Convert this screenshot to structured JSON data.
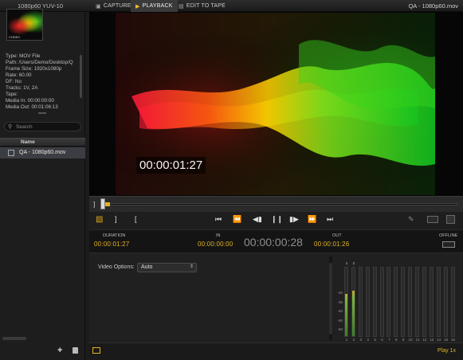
{
  "topbar": {
    "format": "1080p60  YUV-10",
    "tabs": [
      {
        "label": "CAPTURE",
        "icon": "camera-icon"
      },
      {
        "label": "PLAYBACK",
        "icon": "play-icon"
      },
      {
        "label": "EDIT TO TAPE",
        "icon": "tape-icon"
      }
    ],
    "title": "QA - 1080p60.mov"
  },
  "thumbnail": {
    "tag": "CODEC"
  },
  "metadata": [
    "Type: MOV File",
    "Path: /Users/Demo/Desktop/Q",
    "Frame Size: 1920x1080p",
    "Rate: 60.00",
    "DF: No",
    "Tracks: 1V, 2A",
    "Tape:",
    "Media In: 00:00:00:00",
    "Media Out: 00:01:06:13"
  ],
  "search": {
    "placeholder": "Search"
  },
  "bin": {
    "column_name": "Name",
    "items": [
      {
        "name": "QA - 1080p60.mov",
        "icon": "clip-icon"
      }
    ]
  },
  "video": {
    "timecode_overlay": "00:00:01:27"
  },
  "transport": {
    "buttons": [
      "jump-start-icon",
      "rewind-icon",
      "step-back-icon",
      "pause-icon",
      "step-forward-icon",
      "fast-forward-icon",
      "jump-end-icon"
    ]
  },
  "timecodes": {
    "duration_label": "DURATION",
    "duration": "00:00:01:27",
    "in_label": "IN",
    "in": "00:00:00:00",
    "current": "00:00:00:28",
    "out_label": "OUT",
    "out": "00:00:01:26",
    "offline_label": "OFFLINE"
  },
  "video_options": {
    "label": "Video Options:",
    "value": "Auto"
  },
  "meters": {
    "active_labels": [
      "1",
      "2"
    ],
    "channels": [
      "1",
      "2",
      "3",
      "4",
      "5",
      "6",
      "7",
      "8",
      "9",
      "10",
      "11",
      "12",
      "13",
      "14",
      "15",
      "16"
    ],
    "scale": [
      "-20",
      "-30",
      "-40",
      "-50",
      "-60"
    ],
    "levels": [
      0.62,
      0.66,
      0,
      0,
      0,
      0,
      0,
      0,
      0,
      0,
      0,
      0,
      0,
      0,
      0,
      0
    ]
  },
  "status": {
    "text": "Play 1x"
  },
  "colors": {
    "accent": "#e2b424"
  }
}
